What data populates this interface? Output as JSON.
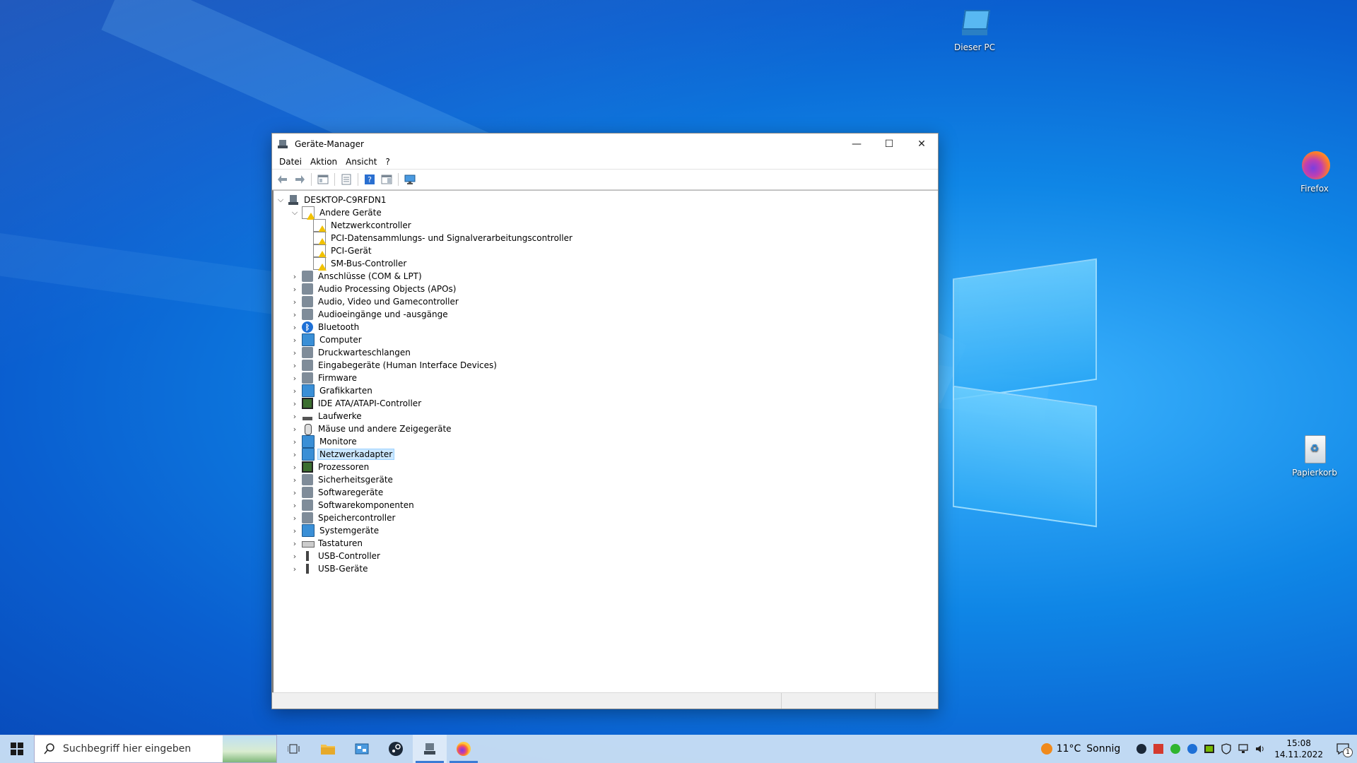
{
  "desktop": {
    "icons": [
      {
        "label": "Dieser PC"
      },
      {
        "label": "Firefox"
      },
      {
        "label": "Papierkorb"
      }
    ]
  },
  "window": {
    "title": "Geräte-Manager",
    "controls": {
      "minimize": "—",
      "maximize": "☐",
      "close": "✕"
    },
    "menu": [
      "Datei",
      "Aktion",
      "Ansicht",
      "?"
    ],
    "tree": {
      "root": "DESKTOP-C9RFDN1",
      "andere": {
        "label": "Andere Geräte",
        "children": [
          "Netzwerkcontroller",
          "PCI-Datensammlungs- und Signalverarbeitungscontroller",
          "PCI-Gerät",
          "SM-Bus-Controller"
        ]
      },
      "categories": [
        "Anschlüsse (COM & LPT)",
        "Audio Processing Objects (APOs)",
        "Audio, Video und Gamecontroller",
        "Audioeingänge und -ausgänge",
        "Bluetooth",
        "Computer",
        "Druckwarteschlangen",
        "Eingabegeräte (Human Interface Devices)",
        "Firmware",
        "Grafikkarten",
        "IDE ATA/ATAPI-Controller",
        "Laufwerke",
        "Mäuse und andere Zeigegeräte",
        "Monitore",
        "Netzwerkadapter",
        "Prozessoren",
        "Sicherheitsgeräte",
        "Softwaregeräte",
        "Softwarekomponenten",
        "Speichercontroller",
        "Systemgeräte",
        "Tastaturen",
        "USB-Controller",
        "USB-Geräte"
      ],
      "selected": "Netzwerkadapter"
    }
  },
  "taskbar": {
    "search_placeholder": "Suchbegriff hier eingeben",
    "weather": {
      "temp": "11°C",
      "condition": "Sonnig"
    },
    "clock": {
      "time": "15:08",
      "date": "14.11.2022"
    },
    "notification_count": "1"
  },
  "colors": {
    "selection": "#cce8ff",
    "taskbar": "#c8def4",
    "accent": "#3a7bd5"
  }
}
